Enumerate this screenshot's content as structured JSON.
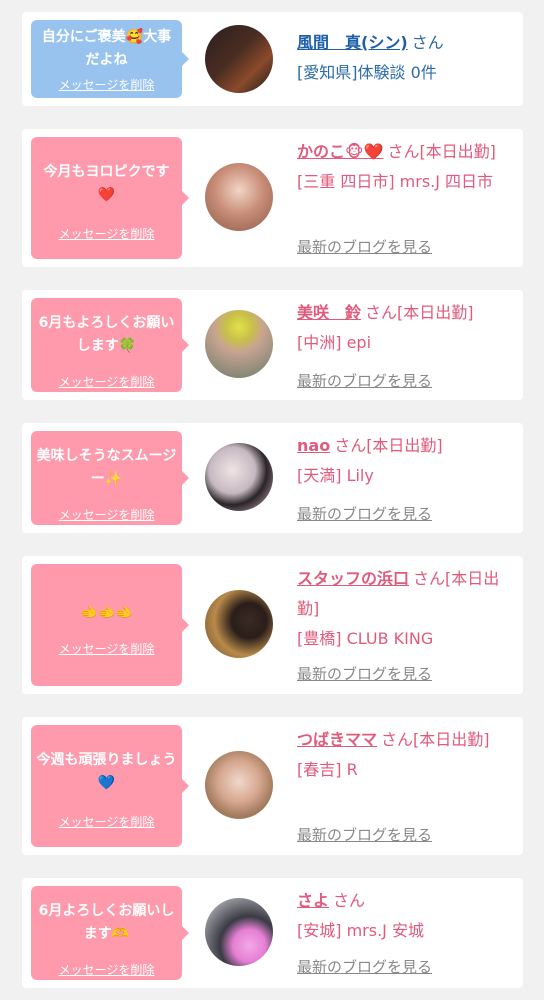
{
  "messages": [
    {
      "bubble_text": "自分にご褒美🥰大事だよね",
      "delete_label": "メッセージを削除",
      "name": "風間　真(シン)",
      "san": "さん",
      "detail": "[愛知県]体験談 0件",
      "blog": "",
      "bubble_color": "#99c3ef",
      "avatar_color": "#3a2a2a"
    },
    {
      "bubble_text": "今月もヨロピクです❤️",
      "delete_label": "メッセージを削除",
      "name": "かのこ🐵❤️",
      "san": "さん[本日出勤]",
      "detail": "[三重 四日市] mrs.J 四日市",
      "blog": "最新のブログを見る",
      "bubble_color": "#fe9aac",
      "avatar_color": "#c89a88"
    },
    {
      "bubble_text": "6月もよろしくお願いします🍀",
      "delete_label": "メッセージを削除",
      "name": "美咲　鈴",
      "san": "さん[本日出勤]",
      "detail": "[中洲] epi",
      "blog": "最新のブログを見る",
      "bubble_color": "#fe9aac",
      "avatar_color": "#8e9a78"
    },
    {
      "bubble_text": "美味しそうなスムージー✨",
      "delete_label": "メッセージを削除",
      "name": "nao",
      "san": "さん[本日出勤]",
      "detail": "[天満] Lily",
      "blog": "最新のブログを見る",
      "bubble_color": "#fe9aac",
      "avatar_color": "#d7c9c8"
    },
    {
      "bubble_text": "🫲🫲🫲",
      "delete_label": "メッセージを削除",
      "name": "スタッフの浜口",
      "san": "さん[本日出勤]",
      "detail": "[豊橋] CLUB KING",
      "blog": "最新のブログを見る",
      "bubble_color": "#fe9aac",
      "avatar_color": "#8a6a48"
    },
    {
      "bubble_text": "今週も頑張りましょう💙",
      "delete_label": "メッセージを削除",
      "name": "つばきママ",
      "san": "さん[本日出勤]",
      "detail": "[春吉] R",
      "blog": "最新のブログを見る",
      "bubble_color": "#fe9aac",
      "avatar_color": "#c7a08a"
    },
    {
      "bubble_text": "6月よろしくお願いします🫶",
      "delete_label": "メッセージを削除",
      "name": "さよ",
      "san": "さん",
      "detail": "[安城] mrs.J 安城",
      "blog": "最新のブログを見る",
      "bubble_color": "#fe9aac",
      "avatar_color": "#4a4a55"
    }
  ]
}
